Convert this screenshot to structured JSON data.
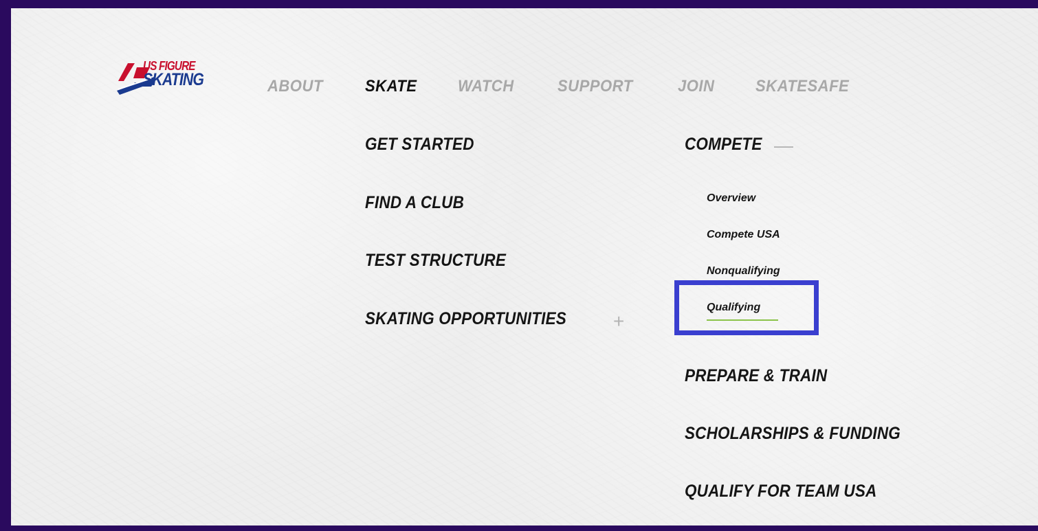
{
  "brand": {
    "logo_line1": "US FIGURE",
    "logo_line2": "SKATING",
    "colors": {
      "red": "#c8102e",
      "blue": "#1a3a8f"
    }
  },
  "top_nav": {
    "items": [
      {
        "label": "ABOUT"
      },
      {
        "label": "SKATE"
      },
      {
        "label": "WATCH"
      },
      {
        "label": "SUPPORT"
      },
      {
        "label": "JOIN"
      },
      {
        "label": "SKATESAFE"
      }
    ],
    "active": "SKATE"
  },
  "skate_menu": {
    "left_column": [
      {
        "label": "GET STARTED"
      },
      {
        "label": "FIND A CLUB"
      },
      {
        "label": "TEST STRUCTURE"
      },
      {
        "label": "SKATING OPPORTUNITIES",
        "toggle": "+"
      }
    ],
    "right_column": [
      {
        "label": "COMPETE",
        "toggle": "—",
        "expanded": true,
        "children": [
          {
            "label": "Overview"
          },
          {
            "label": "Compete USA"
          },
          {
            "label": "Nonqualifying"
          },
          {
            "label": "Qualifying",
            "highlighted": true
          }
        ]
      },
      {
        "label": "PREPARE & TRAIN"
      },
      {
        "label": "SCHOLARSHIPS & FUNDING"
      },
      {
        "label": "QUALIFY FOR TEAM USA"
      }
    ]
  },
  "colors": {
    "frame": "#2a0a5e",
    "highlight_box": "#3a3fcf",
    "inactive_nav": "#a8a8a8",
    "text": "#151515"
  }
}
